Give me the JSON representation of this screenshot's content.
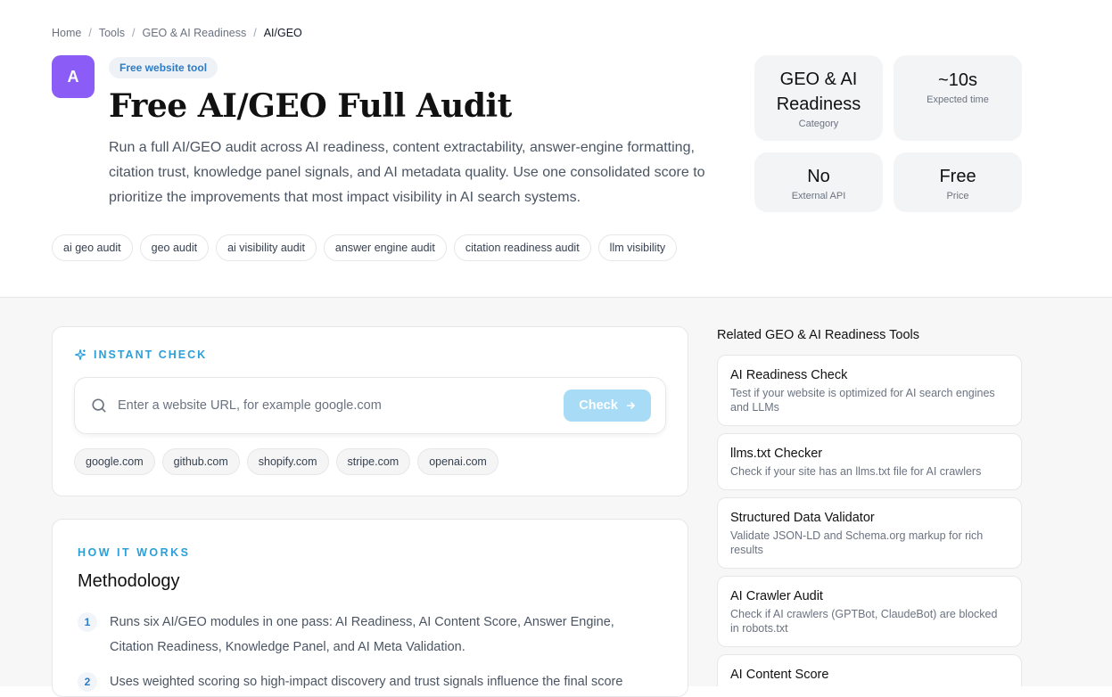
{
  "breadcrumb": [
    "Home",
    "Tools",
    "GEO & AI Readiness",
    "AI/GEO"
  ],
  "avatar_letter": "A",
  "badge": "Free website tool",
  "title": "Free AI/GEO Full Audit",
  "description": "Run a full AI/GEO audit across AI readiness, content extractability, answer-engine formatting, citation trust, knowledge panel signals, and AI metadata quality. Use one consolidated score to prioritize the improvements that most impact visibility in AI search systems.",
  "tags": [
    "ai geo audit",
    "geo audit",
    "ai visibility audit",
    "answer engine audit",
    "citation readiness audit",
    "llm visibility"
  ],
  "stats": [
    {
      "value": "GEO & AI Readiness",
      "label": "Category"
    },
    {
      "value": "~10s",
      "label": "Expected time"
    },
    {
      "value": "No",
      "label": "External API"
    },
    {
      "value": "Free",
      "label": "Price"
    }
  ],
  "instant_check": {
    "label": "INSTANT CHECK",
    "placeholder": "Enter a website URL, for example google.com",
    "button": "Check",
    "examples": [
      "google.com",
      "github.com",
      "shopify.com",
      "stripe.com",
      "openai.com"
    ]
  },
  "how_it_works": {
    "label": "HOW IT WORKS",
    "title": "Methodology",
    "steps": [
      {
        "num": "1",
        "text": "Runs six AI/GEO modules in one pass: AI Readiness, AI Content Score, Answer Engine, Citation Readiness, Knowledge Panel, and AI Meta Validation."
      },
      {
        "num": "2",
        "text": "Uses weighted scoring so high-impact discovery and trust signals influence the final score"
      }
    ]
  },
  "related": {
    "title": "Related GEO & AI Readiness Tools",
    "items": [
      {
        "name": "AI Readiness Check",
        "desc": "Test if your website is optimized for AI search engines and LLMs"
      },
      {
        "name": "llms.txt Checker",
        "desc": "Check if your site has an llms.txt file for AI crawlers"
      },
      {
        "name": "Structured Data Validator",
        "desc": "Validate JSON-LD and Schema.org markup for rich results"
      },
      {
        "name": "AI Crawler Audit",
        "desc": "Check if AI crawlers (GPTBot, ClaudeBot) are blocked in robots.txt"
      },
      {
        "name": "AI Content Score",
        "desc": ""
      }
    ]
  },
  "colors": {
    "accent": "#2b9fd9",
    "avatar": "#8b5cf6",
    "check_button": "#a8dbf5"
  }
}
